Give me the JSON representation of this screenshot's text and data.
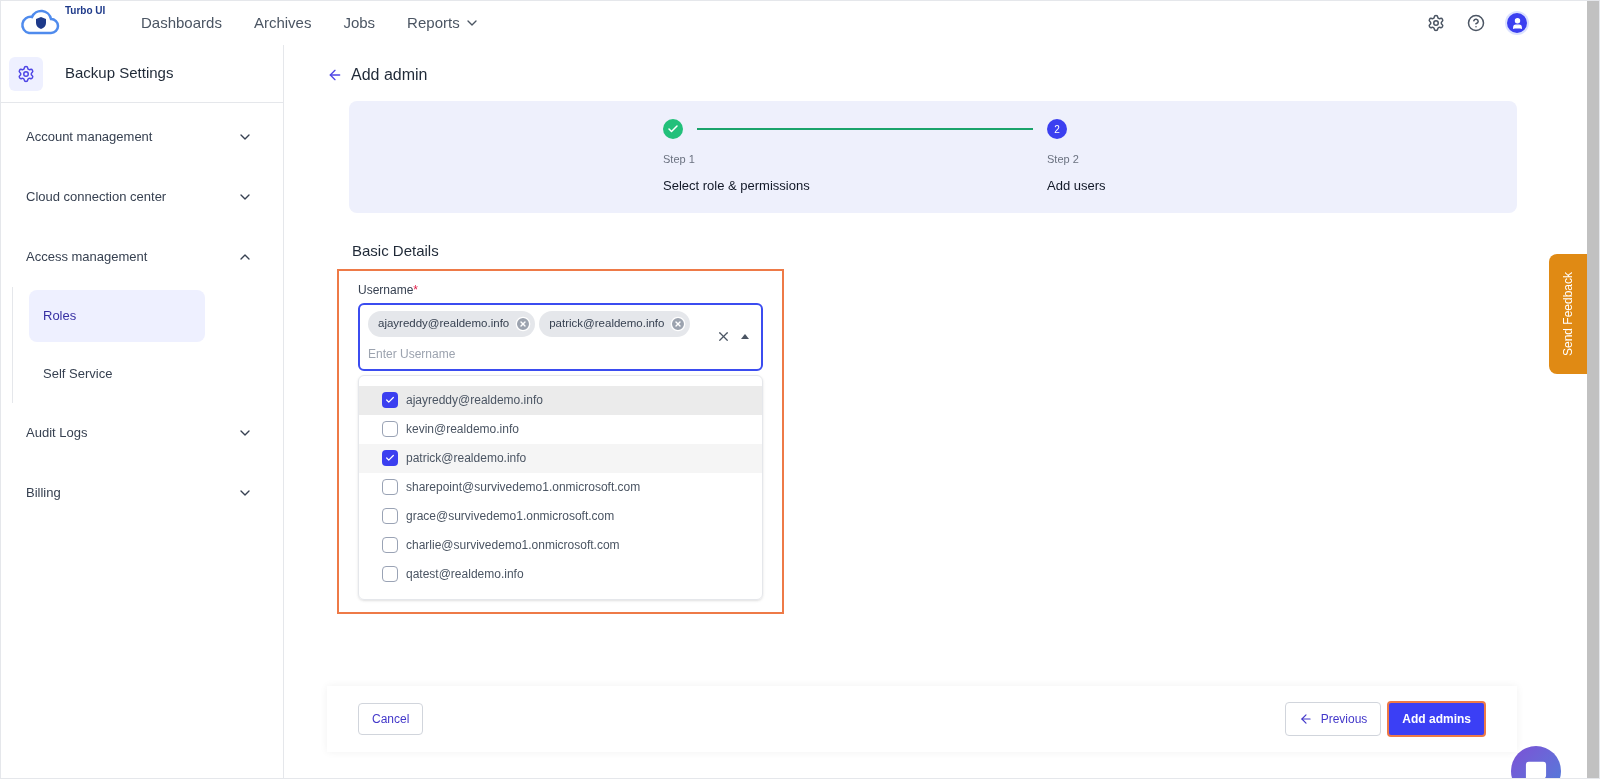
{
  "brand": {
    "name": "Turbo UI"
  },
  "nav": [
    {
      "label": "Dashboards",
      "dropdown": false
    },
    {
      "label": "Archives",
      "dropdown": false
    },
    {
      "label": "Jobs",
      "dropdown": false
    },
    {
      "label": "Reports",
      "dropdown": true
    }
  ],
  "sidebar": {
    "title": "Backup Settings",
    "items": [
      {
        "label": "Account management",
        "expanded": false
      },
      {
        "label": "Cloud connection center",
        "expanded": false
      },
      {
        "label": "Access management",
        "expanded": true,
        "children": [
          {
            "label": "Roles",
            "selected": true
          },
          {
            "label": "Self Service",
            "selected": false
          }
        ]
      },
      {
        "label": "Audit Logs",
        "expanded": false
      },
      {
        "label": "Billing",
        "expanded": false
      }
    ]
  },
  "page": {
    "title": "Add admin"
  },
  "steps": [
    {
      "label": "Step 1",
      "title": "Select role & permissions",
      "complete": true
    },
    {
      "label": "Step 2",
      "title": "Add users",
      "complete": false,
      "number": "2"
    }
  ],
  "form": {
    "section": "Basic Details",
    "highlighted": true,
    "username": {
      "label": "Username",
      "required": "*",
      "placeholder": "Enter Username",
      "chips": [
        "ajayreddy@realdemo.info",
        "patrick@realdemo.info"
      ],
      "expanded": true
    },
    "options": [
      {
        "label": "ajayreddy@realdemo.info",
        "checked": true,
        "hovered": true
      },
      {
        "label": "kevin@realdemo.info",
        "checked": false,
        "hovered": false
      },
      {
        "label": "patrick@realdemo.info",
        "checked": true,
        "hovered": false
      },
      {
        "label": "sharepoint@survivedemo1.onmicrosoft.com",
        "checked": false,
        "hovered": false
      },
      {
        "label": "grace@survivedemo1.onmicrosoft.com",
        "checked": false,
        "hovered": false
      },
      {
        "label": "charlie@survivedemo1.onmicrosoft.com",
        "checked": false,
        "hovered": false
      },
      {
        "label": "qatest@realdemo.info",
        "checked": false,
        "hovered": false
      }
    ]
  },
  "footer": {
    "cancel": "Cancel",
    "previous": "Previous",
    "submit": {
      "label": "Add admins",
      "highlighted": true
    }
  },
  "feedback": {
    "label": "Send Feedback"
  }
}
